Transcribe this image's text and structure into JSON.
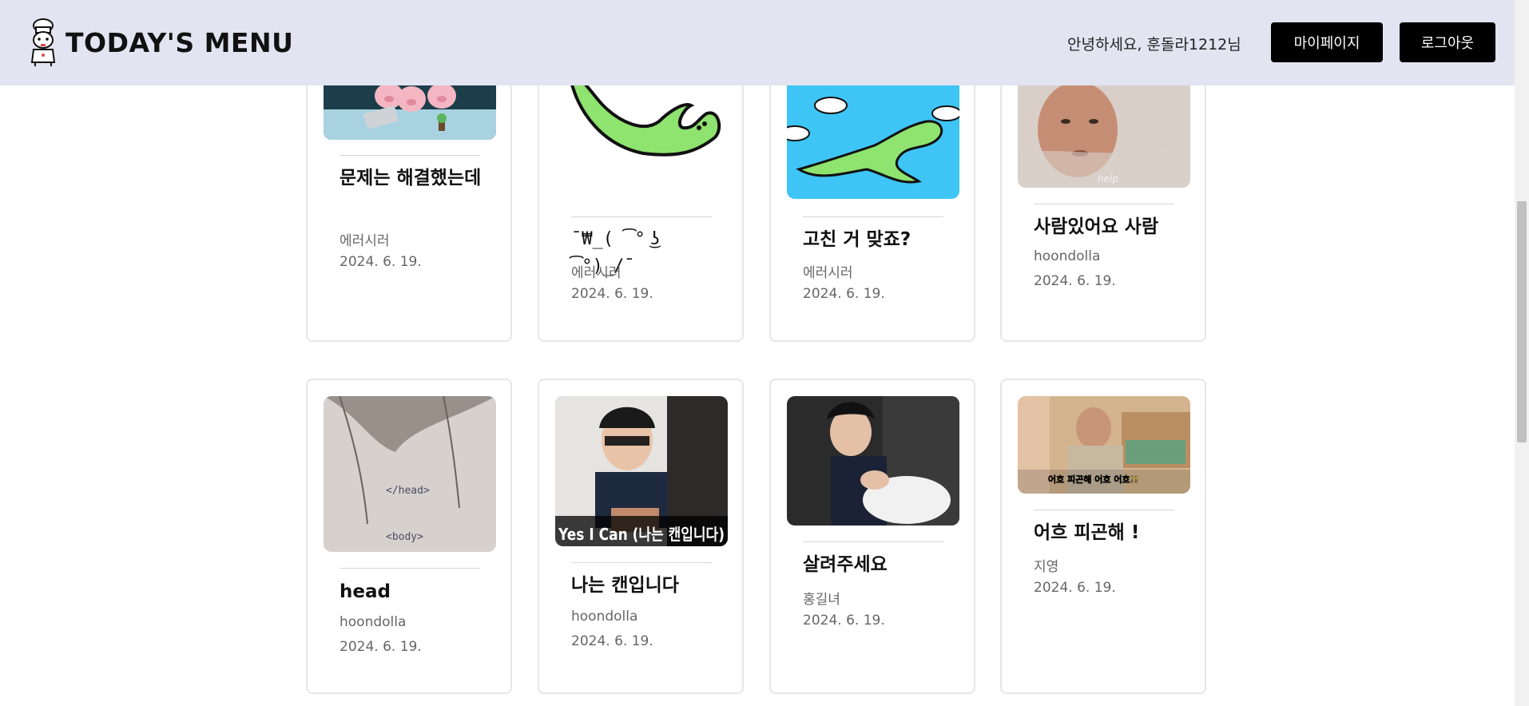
{
  "header": {
    "logo_text": "TODAY'S MENU",
    "greeting": "안녕하세요, 훈돌라1212님",
    "mypage_label": "마이페이지",
    "logout_label": "로그아웃"
  },
  "cards": [
    {
      "title": "문제는 해결했는데",
      "author": "에러시러",
      "date": "2024. 6. 19."
    },
    {
      "title": "¯₩_( ͡° ͜ʖ ͡°)_/¯",
      "author": "에러시러",
      "date": "2024. 6. 19."
    },
    {
      "title": "고친 거 맞죠?",
      "author": "에러시러",
      "date": "2024. 6. 19."
    },
    {
      "title": "사람있어요 사람",
      "author": "hoondolla",
      "date": "2024. 6. 19.",
      "image_caption": "help"
    },
    {
      "title": "head",
      "author": "hoondolla",
      "date": "2024. 6. 19.",
      "image_caption": [
        "</head>",
        "<body>"
      ]
    },
    {
      "title": "나는 캔입니다",
      "author": "hoondolla",
      "date": "2024. 6. 19.",
      "image_caption": "Yes I Can (나는 캔입니다)"
    },
    {
      "title": "살려주세요",
      "author": "홍길녀",
      "date": "2024. 6. 19."
    },
    {
      "title": "어흐 피곤해 !",
      "author": "지영",
      "date": "2024. 6. 19.",
      "image_caption": "어흐 피곤해 어흐 어흐!!"
    }
  ],
  "colors": {
    "header_bg": "#e2e4f1",
    "button_bg": "#000000",
    "card_border": "#e6e6e6",
    "meta_text": "#666666"
  }
}
